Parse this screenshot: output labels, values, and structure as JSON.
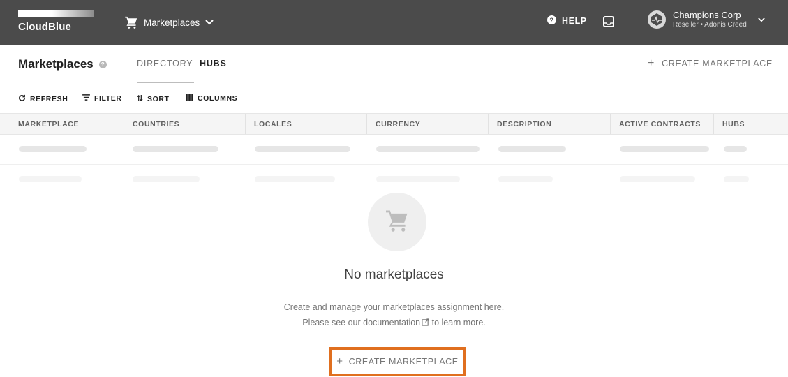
{
  "app": {
    "brand": "CloudBlue",
    "marketplace_switch": "Marketplaces",
    "help": "HELP",
    "account": {
      "name": "Champions Corp",
      "role": "Reseller • Adonis Creed"
    }
  },
  "page": {
    "title": "Marketplaces",
    "info_icon": "?",
    "tabs": [
      {
        "label": "DIRECTORY"
      },
      {
        "label": "HUBS"
      }
    ],
    "create_button": "CREATE MARKETPLACE",
    "plus": "+"
  },
  "toolbar": {
    "refresh": "REFRESH",
    "filter": "FILTER",
    "sort": "SORT",
    "columns": "COLUMNS"
  },
  "table": {
    "columns": [
      "MARKETPLACE",
      "COUNTRIES",
      "LOCALES",
      "CURRENCY",
      "DESCRIPTION",
      "ACTIVE CONTRACTS",
      "HUBS"
    ]
  },
  "empty_state": {
    "title": "No marketplaces",
    "line1": "Create and manage your marketplaces assignment here.",
    "line2_prefix": "Please see our",
    "link": "documentation",
    "line2_suffix": "to learn more.",
    "create_button": "CREATE MARKETPLACE",
    "plus": "+"
  },
  "colors": {
    "topbar": "#4b4b4b",
    "highlight": "#e06f1f"
  },
  "icons": [
    "cart-icon",
    "chevron-down-icon",
    "help-icon",
    "inbox-icon",
    "avatar",
    "refresh-icon",
    "filter-icon",
    "sort-icon",
    "columns-icon",
    "external-link-icon"
  ]
}
